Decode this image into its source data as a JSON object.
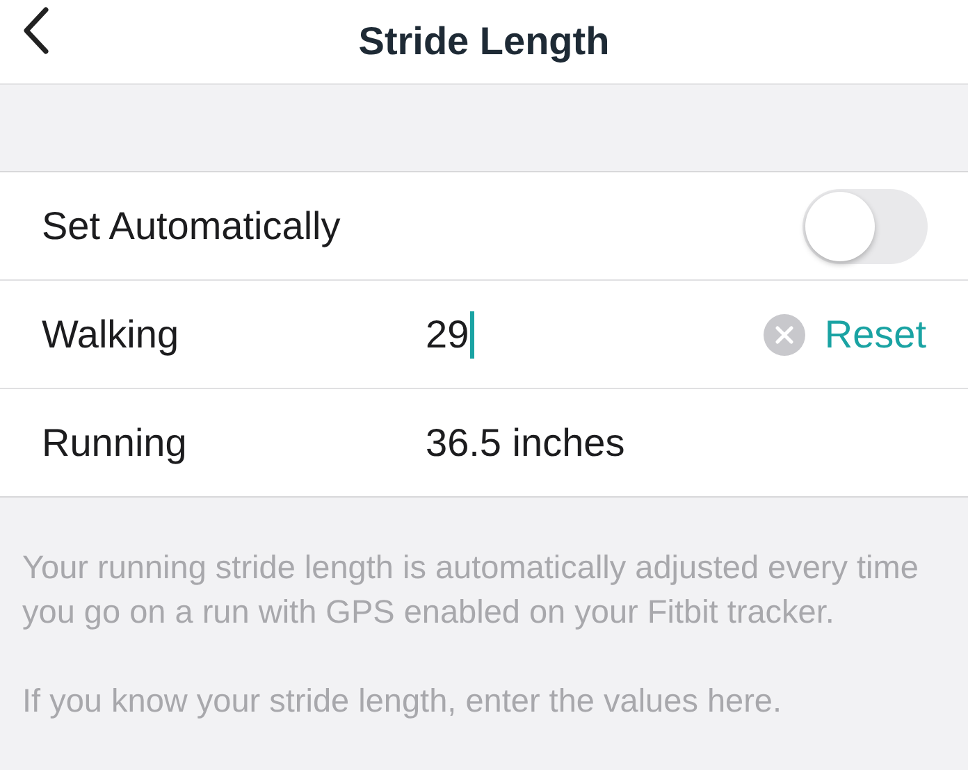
{
  "header": {
    "title": "Stride Length"
  },
  "rows": [
    {
      "kind": "toggle",
      "label": "Set Automatically",
      "on": false
    },
    {
      "kind": "input",
      "label": "Walking",
      "value": "29",
      "focused": true,
      "action": "Reset"
    },
    {
      "kind": "value",
      "label": "Running",
      "value": "36.5 inches"
    }
  ],
  "footer": [
    "Your running stride length is automatically adjusted every time you go on a run with GPS enabled on your Fitbit tracker.",
    "If you know your stride length, enter the values here."
  ]
}
